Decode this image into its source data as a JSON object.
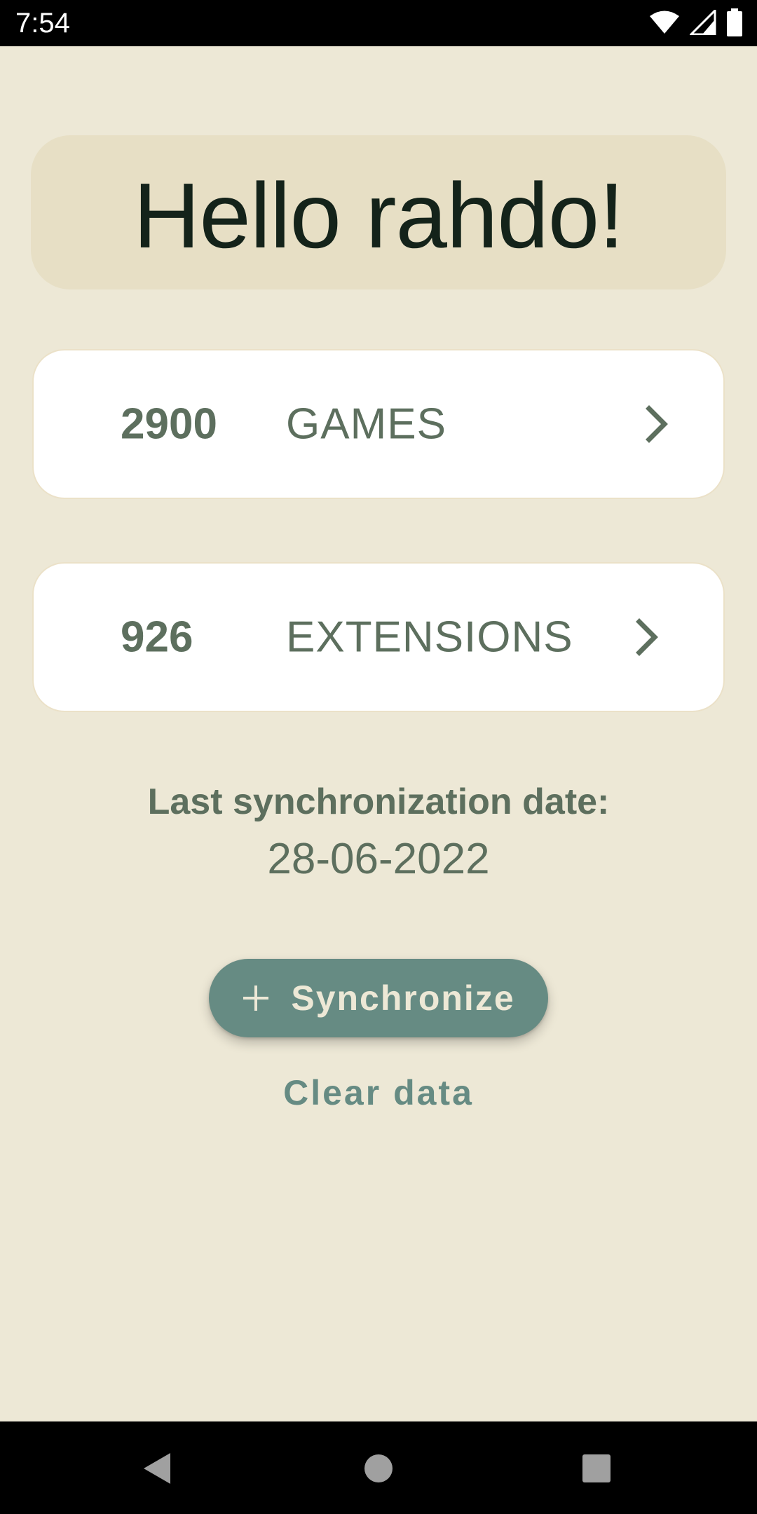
{
  "status_bar": {
    "time": "7:54",
    "icons": [
      "wifi-icon",
      "cell-signal-icon",
      "battery-icon"
    ]
  },
  "greeting": {
    "text": "Hello rahdo!"
  },
  "collections": [
    {
      "count": "2900",
      "label": "GAMES",
      "icon": "chevron-right-icon"
    },
    {
      "count": "926",
      "label": "EXTENSIONS",
      "icon": "chevron-right-icon"
    }
  ],
  "sync": {
    "label": "Last synchronization date:",
    "date": "28-06-2022",
    "button_label": "Synchronize",
    "button_icon": "plus-icon",
    "clear_label": "Clear data"
  },
  "nav_bar": {
    "items": [
      "back-icon",
      "home-icon",
      "recents-icon"
    ]
  },
  "colors": {
    "background": "#ede8d6",
    "greeting_card": "#e7dfc5",
    "accent": "#668b83",
    "text_muted": "#5d6f5e",
    "text_dark": "#14231a"
  }
}
